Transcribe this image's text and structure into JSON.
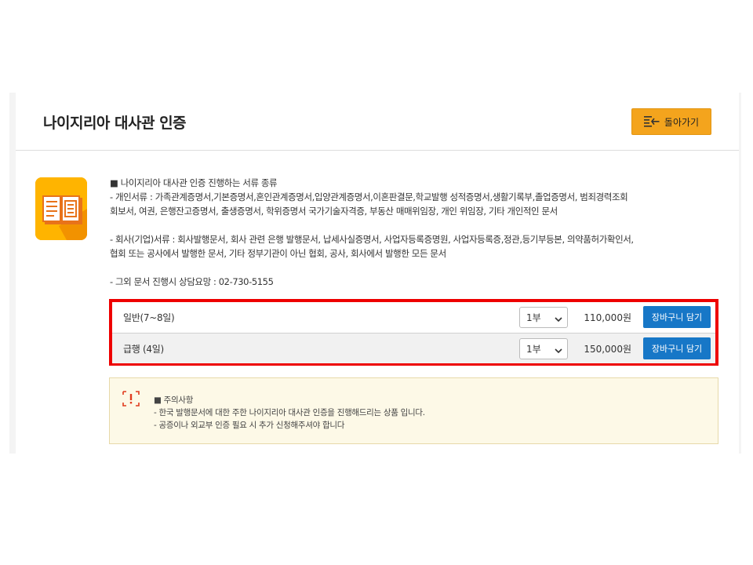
{
  "header": {
    "title": "나이지리아 대사관 인증",
    "back_button_label": "돌아가기",
    "back_icon": "list-back-icon"
  },
  "colors": {
    "accent_orange": "#f4a41d",
    "cart_blue": "#1777c7",
    "highlight_red": "#ee0000",
    "notice_bg": "#fdf9e7"
  },
  "info": {
    "icon": "document-book-icon",
    "heading": "■ 나이지리아 대사관 인증 진행하는 서류 종류",
    "personal_line1": "- 개인서류 : 가족관계증명서,기본증명서,혼인관계증명서,입양관계증명서,이혼판결문,학교발행 성적증명서,생활기록부,졸업증명서, 범죄경력조회",
    "personal_line2": "회보서, 여권, 은행잔고증명서, 출생증명서, 학위증명서 국가기술자격증, 부동산 매매위임장, 개인 위임장, 기타 개인적인 문서",
    "company_line1": "- 회사(기업)서류 : 회사발행문서, 회사 관련 은행 발행문서, 납세사실증명서, 사업자등록증명원, 사업자등록증,정관,등기부등본, 의약품허가확인서,",
    "company_line2": "협회 또는 공사에서 발행한 문서, 기타 정부기관이 아닌 협회, 공사, 회사에서 발행한 모든 문서",
    "contact": "- 그외 문서 진행시 상담요망 : 02-730-5155"
  },
  "options": [
    {
      "name": "일반(7~8일)",
      "qty": "1부",
      "price": "110,000원",
      "cart_label": "장바구니 담기"
    },
    {
      "name": "급행 (4일)",
      "qty": "1부",
      "price": "150,000원",
      "cart_label": "장바구니 담기"
    }
  ],
  "notice": {
    "icon": "warning-icon",
    "heading": "■ 주의사항",
    "line1": "- 한국 발행문서에 대한 주한 나이지리아 대사관 인증을 진행해드리는 상품 입니다.",
    "line2": "- 공증이나 외교부 인증 필요 시 추가 신청해주셔야 합니다"
  }
}
